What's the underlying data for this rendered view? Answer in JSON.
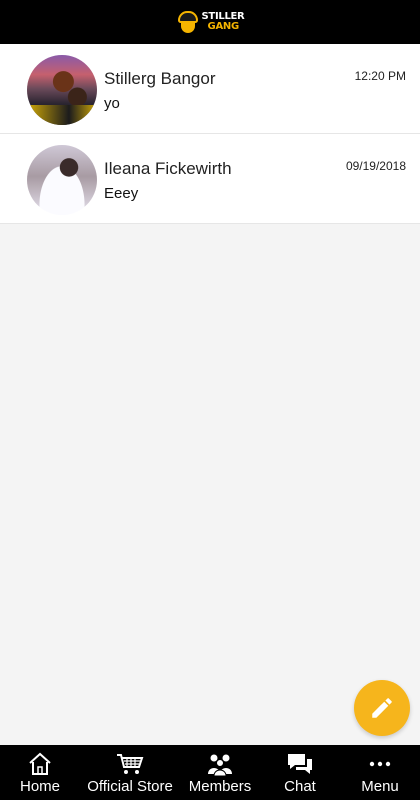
{
  "app": {
    "logo_line1": "STILLER",
    "logo_line2": "GANG"
  },
  "conversations": [
    {
      "name": "Stillerg Bangor",
      "preview": "yo",
      "time": "12:20 PM"
    },
    {
      "name": "Ileana Fickewirth",
      "preview": "Eeey",
      "time": "09/19/2018"
    }
  ],
  "fab": {
    "icon": "pencil-icon"
  },
  "nav": [
    {
      "label": "Home",
      "icon": "home-icon"
    },
    {
      "label": "Official Store",
      "icon": "cart-icon"
    },
    {
      "label": "Members",
      "icon": "members-icon"
    },
    {
      "label": "Chat",
      "icon": "chat-icon"
    },
    {
      "label": "Menu",
      "icon": "more-icon"
    }
  ],
  "colors": {
    "accent": "#f6b51c",
    "bar": "#000000",
    "background": "#f4f4f4"
  }
}
